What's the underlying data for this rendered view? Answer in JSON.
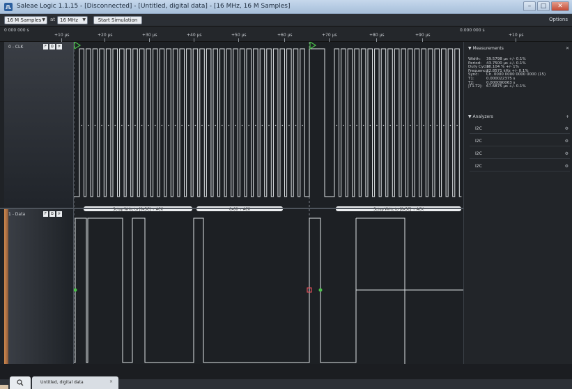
{
  "window": {
    "title": "Saleae Logic 1.1.15 - [Disconnected] - [Untitled, digital data] - [16 MHz, 16 M Samples]",
    "minimize": "–",
    "maximize": "□",
    "close": "✕"
  },
  "toolbar": {
    "samples": "16 M Samples",
    "at": "at",
    "rate": "16 MHz",
    "start": "Start Simulation",
    "options": "Options"
  },
  "ruler": {
    "left_label": "0 000 000 s",
    "right_label": "0.000 000 s",
    "ticks": [
      "+10 µs",
      "+20 µs",
      "+30 µs",
      "+40 µs",
      "+50 µs",
      "+60 µs",
      "+70 µs",
      "+80 µs",
      "+90 µs",
      "+10 µs"
    ]
  },
  "channels": [
    {
      "name": "0 - CLK",
      "buttons": [
        "F",
        "Ω",
        "⟳"
      ]
    },
    {
      "name": "1 - Data",
      "buttons": [
        "F",
        "Ω",
        "⟳"
      ]
    }
  ],
  "decoder_bubbles": [
    "Setup Write to [0x3C] + ACK",
    "0x00 + ACK",
    "Setup Write to [0x3C] + ACK"
  ],
  "measurements": {
    "header": "Measurements",
    "rows": [
      {
        "k": "Width:",
        "v": "39.5798 µs +/- 0.1%"
      },
      {
        "k": "Period:",
        "v": "43.7500 µs +/- 0.1%"
      },
      {
        "k": "Duty Cycle:",
        "v": "30.104 % +/- 1%"
      },
      {
        "k": "Frequency:",
        "v": "22.8571 kHz +/- 0.1%"
      },
      {
        "k": "Sync:",
        "v": "Ch. 0000 0000 0000 0000 (15)"
      },
      {
        "k": "T1:",
        "v": "0.000022375 s"
      },
      {
        "k": "T2:",
        "v": "0.000090063 s"
      },
      {
        "k": "|T1-T2|:",
        "v": "67.6875 µs +/- 0.1%"
      }
    ]
  },
  "analyzers": {
    "header": "Analyzers",
    "rows": [
      "I2C",
      "I2C",
      "I2C",
      "I2C"
    ]
  },
  "tabs": {
    "active_label": "Untitled, digital data",
    "close": "×"
  },
  "colors": {
    "waveform": "#dfe3e6",
    "marker_green": "#4bc24b",
    "marker_red": "#e0505a",
    "bubble_bg": "#eef0f2"
  }
}
